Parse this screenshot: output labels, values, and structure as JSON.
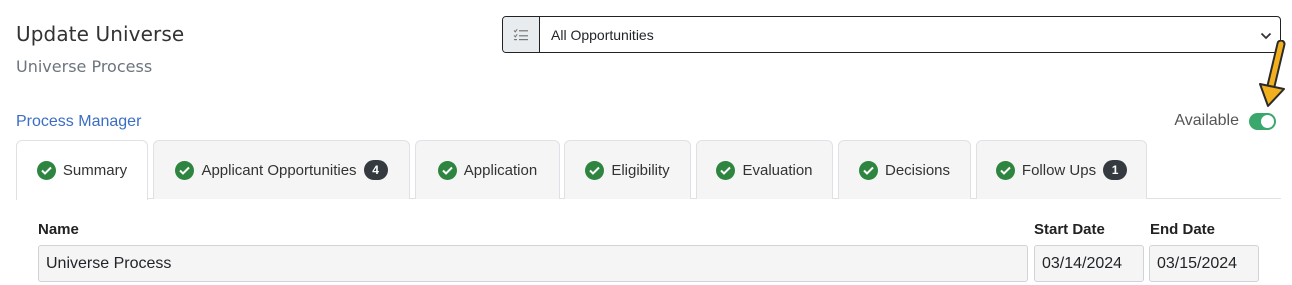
{
  "header": {
    "title": "Update Universe",
    "subtitle": "Universe Process"
  },
  "filter": {
    "icon": "list-check-icon",
    "selected": "All Opportunities"
  },
  "process_manager_link": "Process Manager",
  "availability": {
    "label": "Available",
    "enabled": true,
    "toggle_color": "#3aa76d"
  },
  "annotation": {
    "icon": "arrow-down-left-icon",
    "color": "#f2b01e"
  },
  "tabs": [
    {
      "label": "Summary",
      "status": "complete",
      "active": true
    },
    {
      "label": "Applicant Opportunities",
      "status": "complete",
      "badge": "4"
    },
    {
      "label": "Application",
      "status": "complete"
    },
    {
      "label": "Eligibility",
      "status": "complete"
    },
    {
      "label": "Evaluation",
      "status": "complete"
    },
    {
      "label": "Decisions",
      "status": "complete"
    },
    {
      "label": "Follow Ups",
      "status": "complete",
      "badge": "1"
    }
  ],
  "form": {
    "name_label": "Name",
    "name_value": "Universe Process",
    "start_date_label": "Start Date",
    "start_date_value": "03/14/2024",
    "end_date_label": "End Date",
    "end_date_value": "03/15/2024"
  },
  "colors": {
    "link": "#3b6dc4",
    "check": "#2e8540",
    "badge": "#343a40"
  }
}
